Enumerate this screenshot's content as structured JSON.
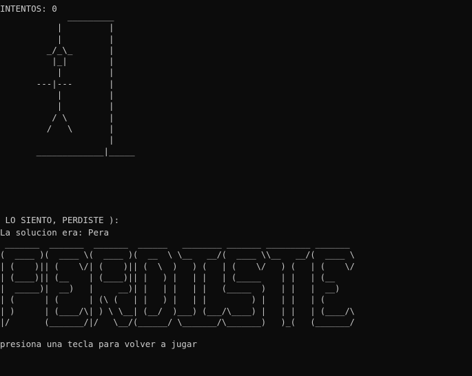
{
  "window": {
    "background": "#0c0c0c",
    "foreground": "#cccccc"
  },
  "console": {
    "attempts_line": "INTENTOS: 0",
    "gallows_art": "             _________\n           |         |\n           |         |\n         _/_\\_       |\n          |_|        |\n           |         |\n       ---|---       |\n           |         |\n           |         |\n          / \\        |\n         /   \\       |\n                     |\n       _____________|_____",
    "lost_message": " LO SIENTO, PERDISTE ):",
    "solution_line": "La solucion era: Pera",
    "perdiste_banner": " _______  _______  _______  ______   ________ _______ _________ _______ \n(  ____ )(  ____ \\(  ____ )(  __  \\ \\__   __/(  ____ \\\\__   __/(  ____ \\\n| (    )|| (    \\/| (    )|| (  \\  )   ) (   | (    \\/   ) (   | (    \\/\n| (____)|| (__    | (____)|| |   ) |   | |   | (_____    | |   | (__    \n|  _____)|  __)   |     __)| |   | |   | |   (_____  )   | |   |  __)   \n| (      | (      | (\\ (   | |   ) |   | |         ) |   | |   | (      \n| )      | (____/\\| ) \\ \\__| (__/  )___) (___/\\____) |   | |   | (____/\\\n|/       (_______/|/   \\__/(______/ \\_______/\\_______)   )_(   (_______/",
    "press_key_line": "presiona una tecla para volver a jugar"
  }
}
